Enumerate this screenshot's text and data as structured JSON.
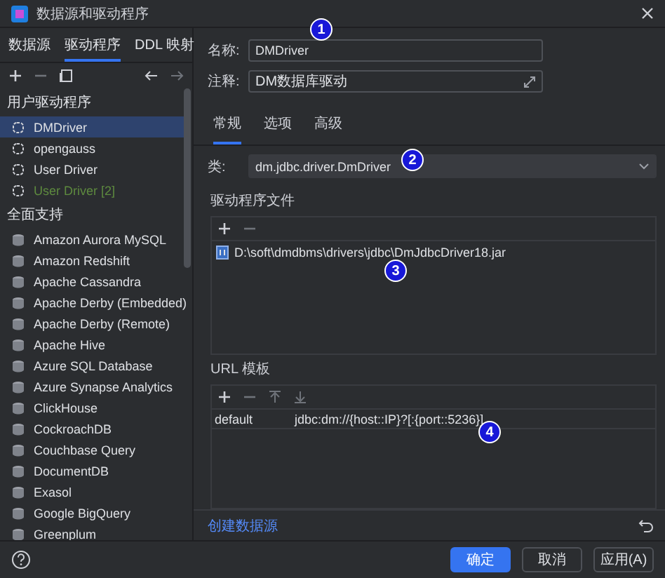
{
  "window": {
    "title": "数据源和驱动程序"
  },
  "sidebar": {
    "tabs": [
      {
        "label": "数据源",
        "selected": false
      },
      {
        "label": "驱动程序",
        "selected": true
      },
      {
        "label": "DDL 映射",
        "selected": false
      }
    ],
    "sections": [
      {
        "title": "用户驱动程序",
        "items": [
          {
            "label": "DMDriver",
            "kind": "user",
            "selected": true,
            "color": "#dfe1e5"
          },
          {
            "label": "opengauss",
            "kind": "user",
            "selected": false,
            "color": "#dfe1e5"
          },
          {
            "label": "User Driver",
            "kind": "user",
            "selected": false,
            "color": "#dfe1e5"
          },
          {
            "label": "User Driver [2]",
            "kind": "user",
            "selected": false,
            "color": "#5e8b3f"
          }
        ]
      },
      {
        "title": "全面支持",
        "items": [
          {
            "label": "Amazon Aurora MySQL",
            "kind": "builtin",
            "selected": false,
            "color": "#dfe1e5"
          },
          {
            "label": "Amazon Redshift",
            "kind": "builtin",
            "selected": false,
            "color": "#dfe1e5"
          },
          {
            "label": "Apache Cassandra",
            "kind": "builtin",
            "selected": false,
            "color": "#dfe1e5"
          },
          {
            "label": "Apache Derby (Embedded)",
            "kind": "builtin",
            "selected": false,
            "color": "#dfe1e5"
          },
          {
            "label": "Apache Derby (Remote)",
            "kind": "builtin",
            "selected": false,
            "color": "#dfe1e5"
          },
          {
            "label": "Apache Hive",
            "kind": "builtin",
            "selected": false,
            "color": "#dfe1e5"
          },
          {
            "label": "Azure SQL Database",
            "kind": "builtin",
            "selected": false,
            "color": "#dfe1e5"
          },
          {
            "label": "Azure Synapse Analytics",
            "kind": "builtin",
            "selected": false,
            "color": "#dfe1e5"
          },
          {
            "label": "ClickHouse",
            "kind": "builtin",
            "selected": false,
            "color": "#dfe1e5"
          },
          {
            "label": "CockroachDB",
            "kind": "builtin",
            "selected": false,
            "color": "#dfe1e5"
          },
          {
            "label": "Couchbase Query",
            "kind": "builtin",
            "selected": false,
            "color": "#dfe1e5"
          },
          {
            "label": "DocumentDB",
            "kind": "builtin",
            "selected": false,
            "color": "#dfe1e5"
          },
          {
            "label": "Exasol",
            "kind": "builtin",
            "selected": false,
            "color": "#dfe1e5"
          },
          {
            "label": "Google BigQuery",
            "kind": "builtin",
            "selected": false,
            "color": "#dfe1e5"
          },
          {
            "label": "Greenplum",
            "kind": "builtin",
            "selected": false,
            "color": "#dfe1e5"
          }
        ]
      }
    ]
  },
  "form": {
    "name_label": "名称:",
    "name_value": "DMDriver",
    "comment_label": "注释:",
    "comment_value": "DM数据库驱动",
    "tabs": [
      {
        "label": "常规",
        "selected": true
      },
      {
        "label": "选项",
        "selected": false
      },
      {
        "label": "高级",
        "selected": false
      }
    ],
    "class_label": "类:",
    "class_value": "dm.jdbc.driver.DmDriver",
    "files_title": "驱动程序文件",
    "files": [
      "D:\\soft\\dmdbms\\drivers\\jdbc\\DmJdbcDriver18.jar"
    ],
    "url_title": "URL 模板",
    "url_rows": [
      {
        "name": "default",
        "template": "jdbc:dm://{host::IP}?[:{port::5236}]"
      }
    ],
    "create_link": "创建数据源"
  },
  "buttons": [
    {
      "label": "确定",
      "kind": "primary"
    },
    {
      "label": "取消",
      "kind": "normal"
    },
    {
      "label": "应用(A)",
      "kind": "normal"
    }
  ],
  "markers": [
    "1",
    "2",
    "3",
    "4"
  ]
}
